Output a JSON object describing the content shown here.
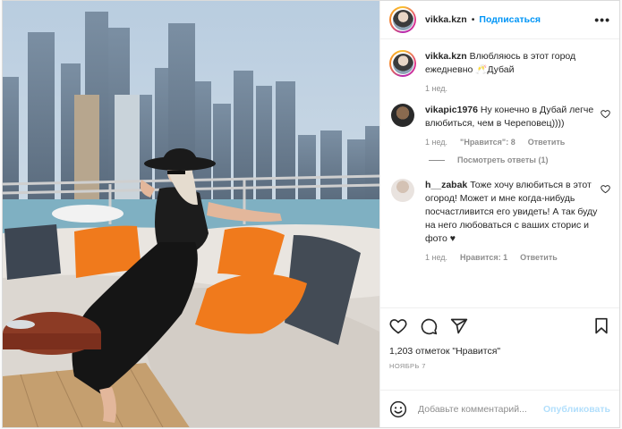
{
  "post": {
    "username": "vikka.kzn",
    "dot": "•",
    "follow_label": "Подписаться",
    "more_label": "•••",
    "caption": {
      "username": "vikka.kzn",
      "text": "Влюбляюсь в этот город ежедневно 🥂Дубай",
      "time": "1 нед."
    },
    "comments": [
      {
        "username": "vikapic1976",
        "text": "Ну конечно в Дубай легче влюбиться, чем в Череповец))))",
        "time": "1 нед.",
        "likes": "\"Нравится\": 8",
        "reply": "Ответить"
      },
      {
        "username": "h__zabak",
        "text": "Тоже хочу влюбиться в этот огород! Может и мне когда-нибудь посчастливится его увидеть! А так буду на него любоваться с ваших сторис и фото ♥",
        "time": "1 нед.",
        "likes": "Нравится: 1",
        "reply": "Ответить"
      }
    ],
    "view_replies": "Посмотреть ответы (1)",
    "likes_count": "1,203 отметок \"Нравится\"",
    "date": "НОЯБРЬ 7",
    "comment_placeholder": "Добавьте комментарий...",
    "publish_label": "Опубликовать",
    "icons": [
      "heart-icon",
      "comment-icon",
      "share-icon",
      "bookmark-icon",
      "emoji-icon",
      "heart-outline-small-icon"
    ],
    "colors": {
      "accent": "#0095f6",
      "publish_disabled": "#b2dffc",
      "muted": "#8e8e8e"
    }
  }
}
